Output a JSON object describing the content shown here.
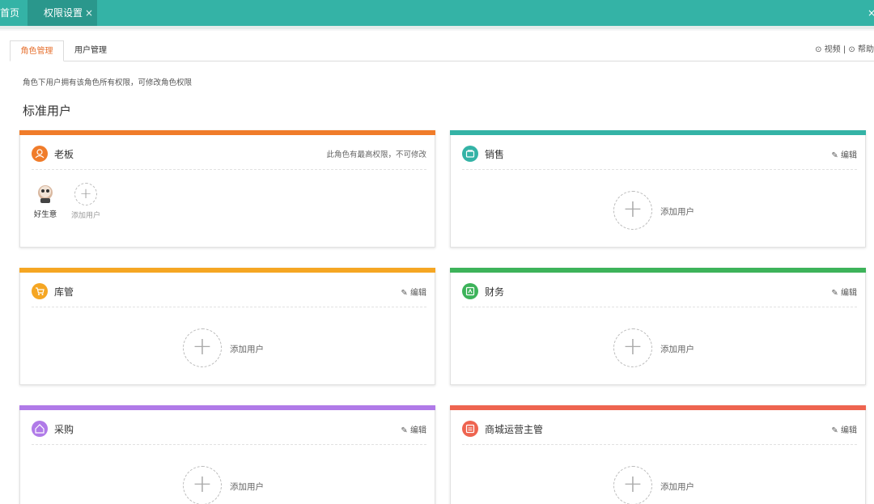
{
  "topbar": {
    "home_label": "首页",
    "active_tab_label": "权限设置",
    "active_tab_close": "×",
    "close_all": "×"
  },
  "subtabs": {
    "roles": "角色管理",
    "users": "用户管理"
  },
  "help": {
    "video": "视频",
    "separator": "|",
    "help": "帮助"
  },
  "description": "角色下用户拥有该角色所有权限，可修改角色权限",
  "section_title": "标准用户",
  "edit_label": "编辑",
  "add_user_label": "添加用户",
  "cards": [
    {
      "name": "老板",
      "color": "#f07c2a",
      "icon": "user-icon",
      "note": "此角色有最高权限，不可修改",
      "members": [
        "好生意"
      ]
    },
    {
      "name": "销售",
      "color": "#34b3a6",
      "icon": "sales-icon"
    },
    {
      "name": "库管",
      "color": "#f5a623",
      "icon": "cart-icon"
    },
    {
      "name": "财务",
      "color": "#3db35a",
      "icon": "finance-icon"
    },
    {
      "name": "采购",
      "color": "#b07ae8",
      "icon": "purchase-icon"
    },
    {
      "name": "商城运营主管",
      "color": "#ee6450",
      "icon": "store-icon"
    }
  ]
}
